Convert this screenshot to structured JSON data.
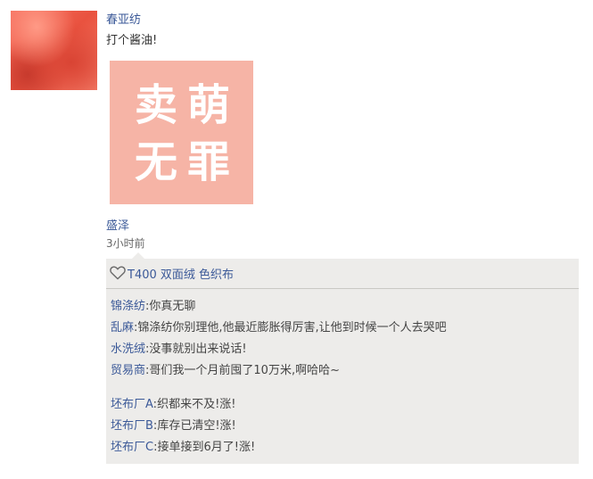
{
  "post": {
    "author": "春亚纺",
    "text": "打个酱油!",
    "image": {
      "icon": "sticker-image",
      "background": "#f6b4a6",
      "glyphs": [
        "卖",
        "萌",
        "无",
        "罪"
      ]
    }
  },
  "shared_name": "盛泽",
  "time": "3小时前",
  "likes": {
    "icon": "heart-icon",
    "label": "T400 双面绒 色织布"
  },
  "comments": [
    {
      "author": "锦涤纺",
      "sep": ":",
      "text": "你真无聊"
    },
    {
      "author": "乱麻",
      "sep": ":",
      "text": "锦涤纺你别理他,他最近膨胀得厉害,让他到时候一个人去哭吧"
    },
    {
      "author": "水洗绒",
      "sep": ":",
      "text": "没事就别出来说话!"
    },
    {
      "author": "贸易商",
      "sep": ":",
      "text": "哥们我一个月前囤了10万米,啊哈哈~"
    },
    {
      "author": "坯布厂A",
      "sep": ":",
      "text": "织都来不及!涨!"
    },
    {
      "author": "坯布厂B",
      "sep": ":",
      "text": "库存已清空!涨!"
    },
    {
      "author": "坯布厂C",
      "sep": ":",
      "text": "接单接到6月了!涨!"
    }
  ],
  "colors": {
    "link": "#3b5998",
    "panel": "#edecea"
  }
}
